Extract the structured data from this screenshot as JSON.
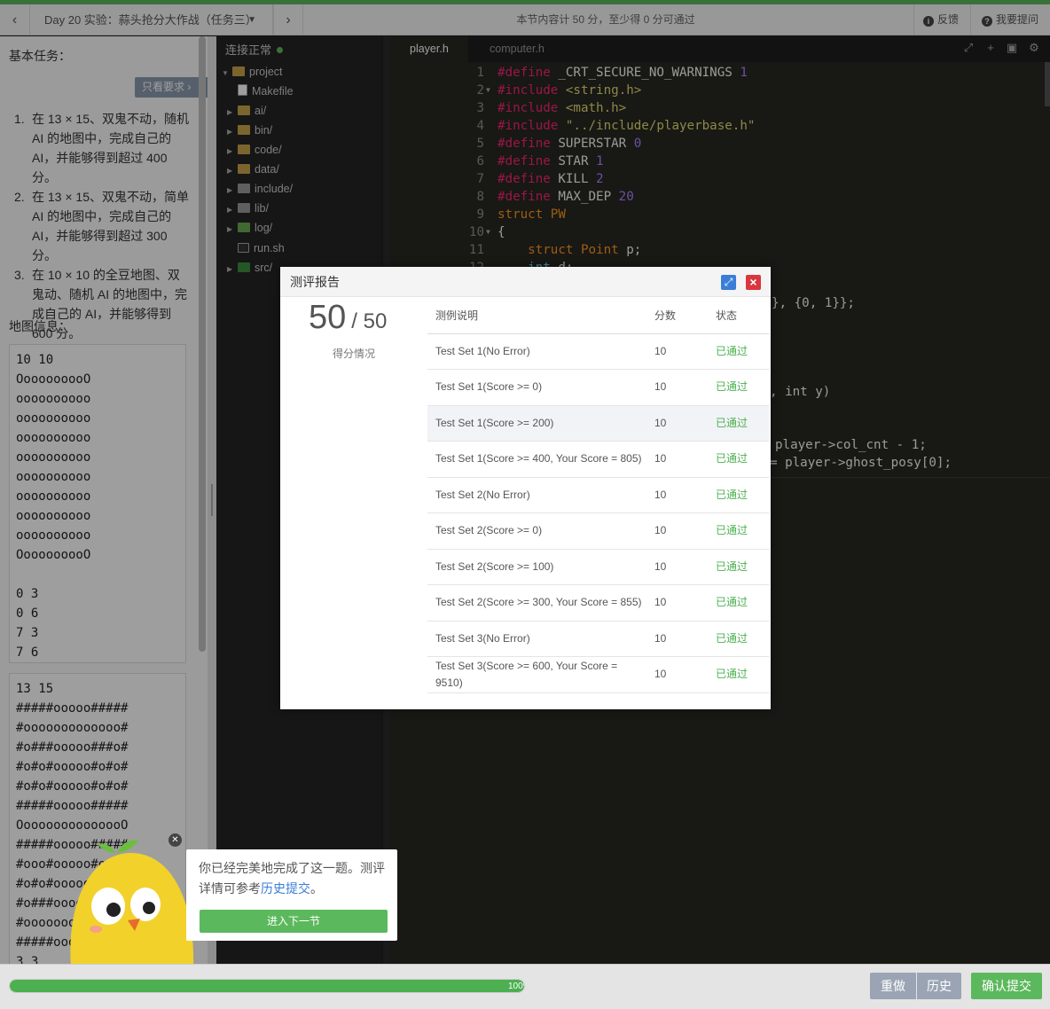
{
  "topbar": {
    "lesson_title": "Day 20 实验：蒜头抢分大作战（任务三）",
    "score_requirement": "本节内容计 50 分，至少得 0 分可通过",
    "feedback": "反馈",
    "ask": "我要提问"
  },
  "left_panel": {
    "task_title": "基本任务：",
    "only_requirements": "只看要求",
    "tasks": [
      {
        "num": "1.",
        "text": "在 13 × 15、双鬼不动，随机 AI 的地图中，完成自己的 AI，并能够得到超过 400 分。"
      },
      {
        "num": "2.",
        "text": "在 13 × 15、双鬼不动，简单 AI 的地图中，完成自己的 AI，并能够得到超过 300 分。"
      },
      {
        "num": "3.",
        "text": "在 10 × 10 的全豆地图、双鬼动、随机 AI 的地图中，完成自己的 AI，并能够得到 600 分。"
      }
    ],
    "map_label": "地图信息：",
    "map1": "10 10\nOooooooooO\noooooooooo\noooooooooo\noooooooooo\noooooooooo\noooooooooo\noooooooooo\noooooooooo\noooooooooo\nOooooooooO\n\n0 3\n0 6\n7 3\n7 6",
    "map2": "13 15\n#####ooooo#####\n#ooooooooooooo#\n#o###ooooo###o#\n#o#o#ooooo#o#o#\n#o#o#ooooo#o#o#\n#####ooooo#####\nOoooooooooooooO\n#####ooooo#####\n#ooo#ooooo#ooo#\n#o#o#ooooo#o#o#\n#o###ooooo###o#\n#ooooooooooooo#\n#####ooooo#####\n3 3"
  },
  "file_panel": {
    "connection": "连接正常",
    "items": [
      {
        "label": "project",
        "icon": "folder-icon",
        "expanded": true
      },
      {
        "label": "Makefile",
        "icon": "file-icon"
      },
      {
        "label": "ai/",
        "icon": "folder-icon"
      },
      {
        "label": "bin/",
        "icon": "folder-icon"
      },
      {
        "label": "code/",
        "icon": "folder-icon"
      },
      {
        "label": "data/",
        "icon": "folder-icon"
      },
      {
        "label": "include/",
        "icon": "folder-icon"
      },
      {
        "label": "lib/",
        "icon": "folder-icon"
      },
      {
        "label": "log/",
        "icon": "folder-icon"
      },
      {
        "label": "run.sh",
        "icon": "shell-icon"
      },
      {
        "label": "src/",
        "icon": "folder-icon"
      }
    ]
  },
  "editor": {
    "tabs": [
      "player.h",
      "computer.h"
    ],
    "line_numbers": [
      "1",
      "2",
      "3",
      "4",
      "5",
      "6",
      "7",
      "8",
      "9",
      "10",
      "11",
      "12"
    ],
    "visible_fragments": [
      "}, {0, 1}};",
      ", int y)",
      "player->col_cnt - 1;",
      "= player->ghost_posy[0];"
    ]
  },
  "modal": {
    "title": "测评报告",
    "score": "50",
    "total": "/ 50",
    "score_caption": "得分情况",
    "headers": [
      "测例说明",
      "分数",
      "状态"
    ],
    "rows": [
      {
        "desc": "Test Set 1(No Error)",
        "score": "10",
        "status": "已通过"
      },
      {
        "desc": "Test Set 1(Score >= 0)",
        "score": "10",
        "status": "已通过"
      },
      {
        "desc": "Test Set 1(Score >= 200)",
        "score": "10",
        "status": "已通过"
      },
      {
        "desc": "Test Set 1(Score >= 400, Your Score = 805)",
        "score": "10",
        "status": "已通过"
      },
      {
        "desc": "Test Set 2(No Error)",
        "score": "10",
        "status": "已通过"
      },
      {
        "desc": "Test Set 2(Score >= 0)",
        "score": "10",
        "status": "已通过"
      },
      {
        "desc": "Test Set 2(Score >= 100)",
        "score": "10",
        "status": "已通过"
      },
      {
        "desc": "Test Set 2(Score >= 300, Your Score = 855)",
        "score": "10",
        "status": "已通过"
      },
      {
        "desc": "Test Set 3(No Error)",
        "score": "10",
        "status": "已通过"
      },
      {
        "desc": "Test Set 3(Score >= 600, Your Score = 9510)",
        "score": "10",
        "status": "已通过"
      }
    ]
  },
  "toast": {
    "text_before": "你已经完美地完成了这一题。测评详情可参考",
    "link": "历史提交",
    "text_after": "。",
    "next_button": "进入下一节"
  },
  "bottombar": {
    "progress": 100,
    "progress_label": "100%",
    "redo": "重做",
    "history": "历史",
    "submit": "确认提交"
  },
  "colors": {
    "accent_green": "#5cb85c",
    "pass_green": "#4caf50",
    "link_blue": "#3a7ed8",
    "close_red": "#d9363e"
  }
}
